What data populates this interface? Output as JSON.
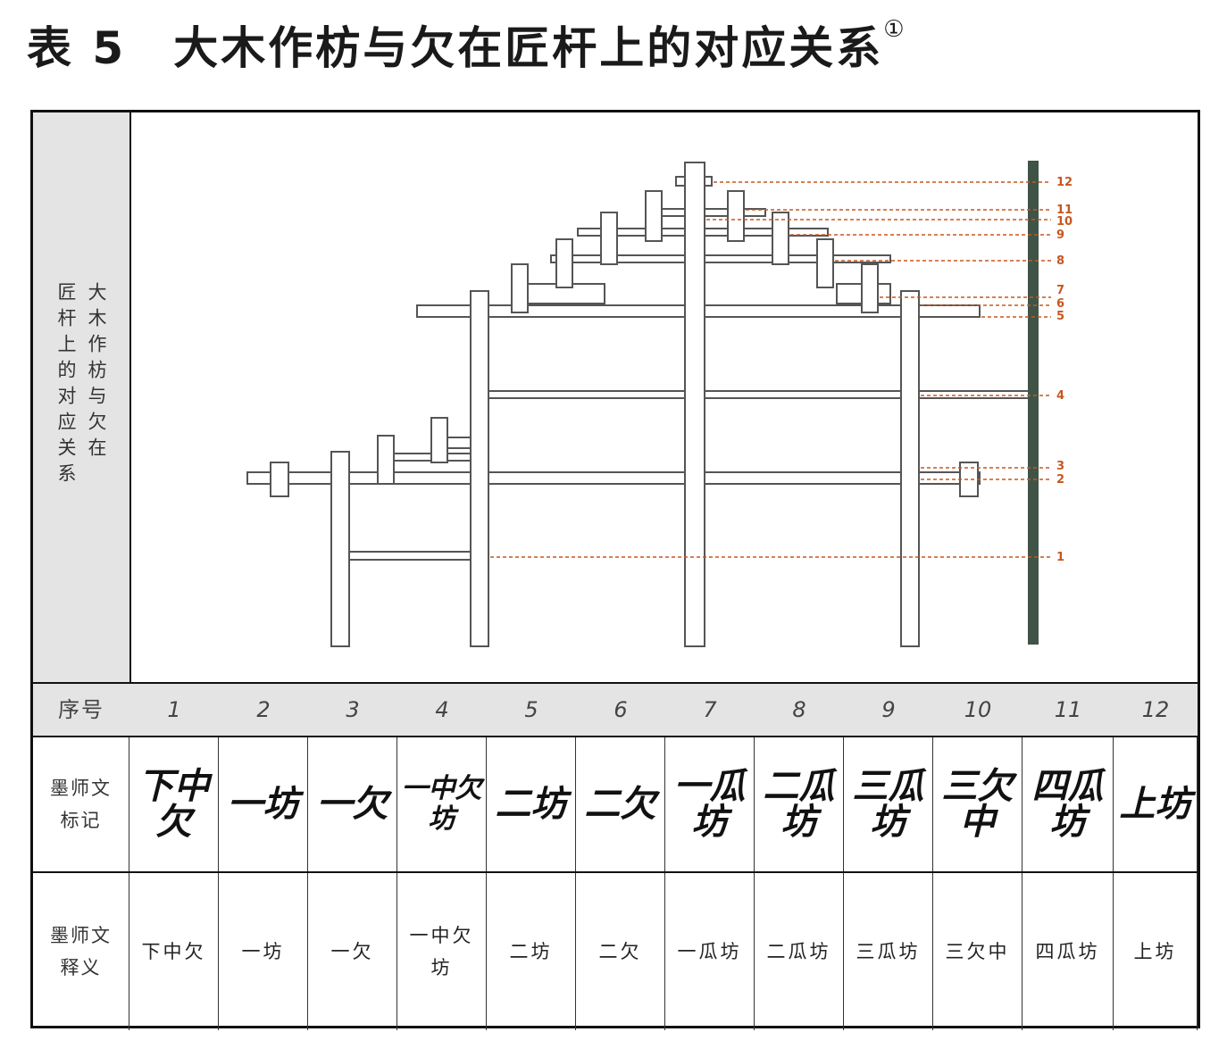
{
  "title": "表 5　大木作枋与欠在匠杆上的对应关系",
  "title_note": "①",
  "side_label": {
    "line1": "大木作枋与欠在",
    "line2": "匠杆上的对应关系"
  },
  "table": {
    "seq_header": "序号",
    "mark_header": "墨师文标记",
    "interp_header": "墨师文释义",
    "columns": [
      {
        "seq": "1",
        "mark": "下中欠",
        "interp": "下中欠"
      },
      {
        "seq": "2",
        "mark": "一坊",
        "interp": "一坊"
      },
      {
        "seq": "3",
        "mark": "一欠",
        "interp": "一欠"
      },
      {
        "seq": "4",
        "mark": "一中欠坊",
        "interp": "一中欠坊"
      },
      {
        "seq": "5",
        "mark": "二坊",
        "interp": "二坊"
      },
      {
        "seq": "6",
        "mark": "二欠",
        "interp": "二欠"
      },
      {
        "seq": "7",
        "mark": "一瓜坊",
        "interp": "一瓜坊"
      },
      {
        "seq": "8",
        "mark": "二瓜坊",
        "interp": "二瓜坊"
      },
      {
        "seq": "9",
        "mark": "三瓜坊",
        "interp": "三瓜坊"
      },
      {
        "seq": "10",
        "mark": "三欠中",
        "interp": "三欠中"
      },
      {
        "seq": "11",
        "mark": "四瓜坊",
        "interp": "四瓜坊"
      },
      {
        "seq": "12",
        "mark": "上坊",
        "interp": "上坊"
      }
    ]
  },
  "diagram": {
    "level_labels": [
      "1",
      "2",
      "3",
      "4",
      "5",
      "6",
      "7",
      "8",
      "9",
      "10",
      "11",
      "12"
    ],
    "colors": {
      "guide": "#c8561f",
      "rod": "#3f5446",
      "frame_stroke": "#555555"
    }
  }
}
